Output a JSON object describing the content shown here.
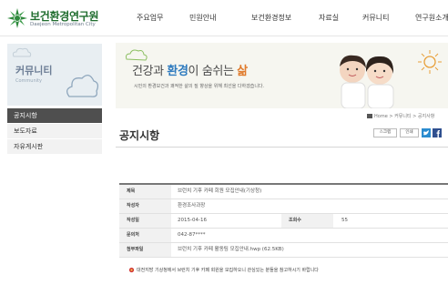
{
  "header": {
    "logo_title": "보건환경연구원",
    "logo_sub": "Daejeon Metropolitan City",
    "nav": [
      "주요업무",
      "민원안내",
      "보건환경정보",
      "자료실",
      "커뮤니티",
      "연구원소개"
    ]
  },
  "sidebar": {
    "title": "커뮤니티",
    "subtitle": "Community",
    "items": [
      {
        "label": "공지시항",
        "active": true
      },
      {
        "label": "보도자료",
        "active": false
      },
      {
        "label": "자유게시판",
        "active": false
      }
    ]
  },
  "banner": {
    "part1": "건강과 ",
    "part2": "환경",
    "part3": "이 숨쉬는 ",
    "part4": "삶",
    "sub": "시민의 환경보건과 쾌적한 삶의 질 향상을 위해 최선을 다하겠습니다."
  },
  "breadcrumb": "Home > 커뮤니티 > 공지사항",
  "page_title": "공지시항",
  "tools": {
    "scrap": "스크랩",
    "print": "인쇄"
  },
  "table": {
    "subject_label": "제목",
    "subject": "브런치 기후 카페 회원 모집안내(기상청)",
    "author_label": "작성자",
    "author": "환경조사과장",
    "date_label": "작성일",
    "date": "2015-04-16",
    "views_label": "조회수",
    "views": "55",
    "contact_label": "문의처",
    "contact": "042-87****",
    "file_label": "첨부파일",
    "file": "브런치 기후 카페 활동팀 모집안내.hwp (62.5KB)"
  },
  "body_text": "대전지방 기상청에서 브런치 기후 카페 회원을 모집하오니 관심있는 분들을 참고하시기 바랍니다",
  "colors": {
    "logo_green": "#1f6d2e",
    "sidebar_active": "#4f4f4f",
    "sns_twitter": "#2b8ccf",
    "sns_facebook": "#2f4f8f"
  }
}
